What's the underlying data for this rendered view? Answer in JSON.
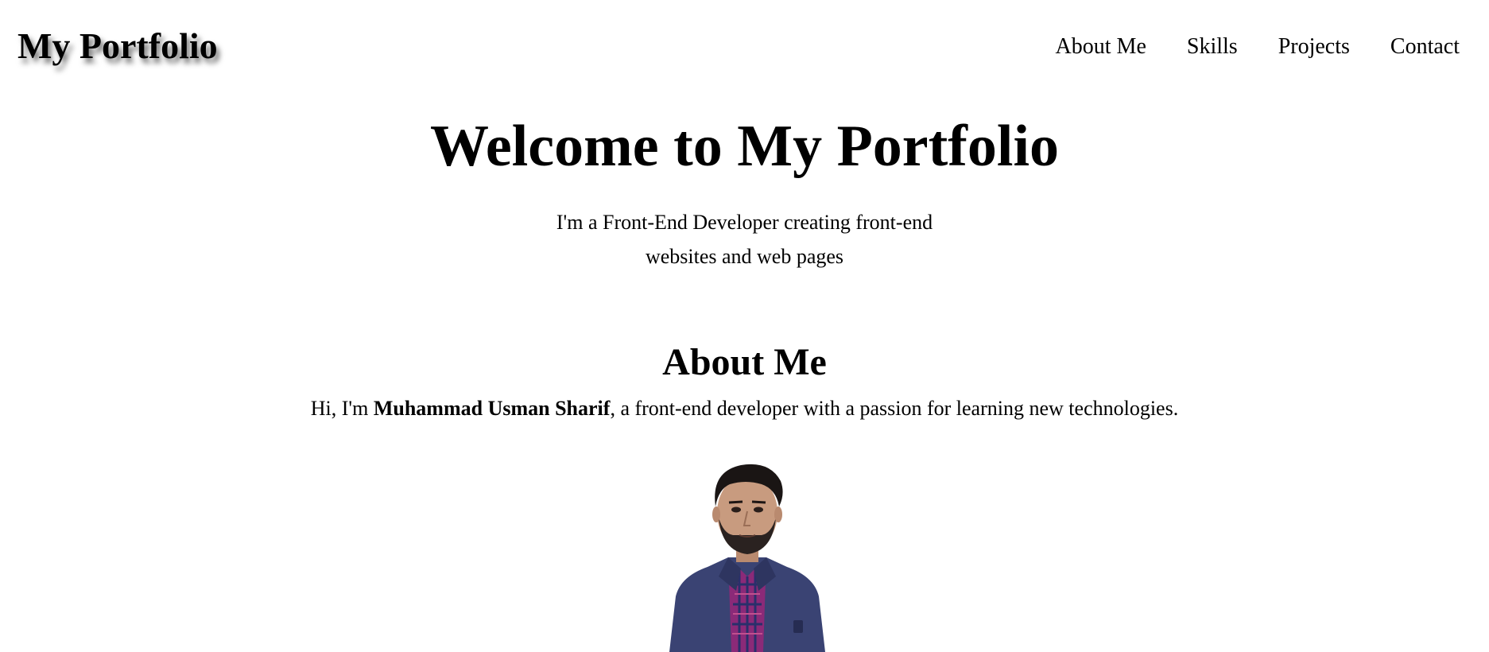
{
  "header": {
    "logo": "My Portfolio",
    "nav": [
      "About Me",
      "Skills",
      "Projects",
      "Contact"
    ]
  },
  "hero": {
    "title": "Welcome to My Portfolio",
    "subtitle": "I'm a Front-End Developer creating front-end websites and web pages"
  },
  "about": {
    "title": "About Me",
    "intro_before": "Hi, I'm ",
    "name": "Muhammad Usman Sharif",
    "intro_after": ", a front-end developer with a passion for learning new technologies."
  },
  "colors": {
    "background": "#ffffff",
    "text": "#000000",
    "jacket": "#3a4373",
    "shirt": "#8b2a78"
  }
}
